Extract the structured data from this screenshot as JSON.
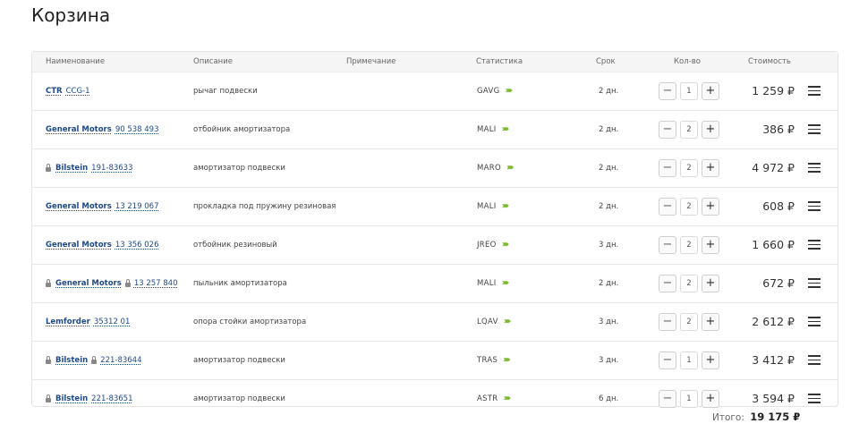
{
  "page": {
    "title": "Корзина"
  },
  "columns": {
    "name": "Наименование",
    "description": "Описание",
    "note": "Примечание",
    "stats": "Статистика",
    "term": "Срок",
    "qty": "Кол-во",
    "cost": "Стоимость"
  },
  "rows": [
    {
      "brand": "CTR",
      "brand_lock": false,
      "part": "CCG-1",
      "part_lock": false,
      "description": "рычаг подвески",
      "stat": "GAVG",
      "days": "2 дн.",
      "qty": "1",
      "price": "1 259 ₽"
    },
    {
      "brand": "General Motors",
      "brand_lock": false,
      "part": "90 538 493",
      "part_lock": false,
      "description": "отбойник амортизатора",
      "stat": "MALI",
      "days": "2 дн.",
      "qty": "2",
      "price": "386 ₽"
    },
    {
      "brand": "Bilstein",
      "brand_lock": true,
      "part": "191-83633",
      "part_lock": false,
      "description": "амортизатор подвески",
      "stat": "MARO",
      "days": "2 дн.",
      "qty": "2",
      "price": "4 972 ₽"
    },
    {
      "brand": "General Motors",
      "brand_lock": false,
      "part": "13 219 067",
      "part_lock": false,
      "description": "прокладка под пружину резиновая",
      "stat": "MALI",
      "days": "2 дн.",
      "qty": "2",
      "price": "608 ₽"
    },
    {
      "brand": "General Motors",
      "brand_lock": false,
      "part": "13 356 026",
      "part_lock": false,
      "description": "отбойник резиновый",
      "stat": "JREO",
      "days": "3 дн.",
      "qty": "2",
      "price": "1 660 ₽"
    },
    {
      "brand": "General Motors",
      "brand_lock": true,
      "part": "13 257 840",
      "part_lock": true,
      "description": "пыльник амортизатора",
      "stat": "MALI",
      "days": "2 дн.",
      "qty": "2",
      "price": "672 ₽"
    },
    {
      "brand": "Lemforder",
      "brand_lock": false,
      "part": "35312 01",
      "part_lock": false,
      "description": "опора стойки амортизатора",
      "stat": "LQAV",
      "days": "3 дн.",
      "qty": "2",
      "price": "2 612 ₽"
    },
    {
      "brand": "Bilstein",
      "brand_lock": true,
      "part": "221-83644",
      "part_lock": true,
      "description": "амортизатор подвески",
      "stat": "TRAS",
      "days": "3 дн.",
      "qty": "1",
      "price": "3 412 ₽"
    },
    {
      "brand": "Bilstein",
      "brand_lock": true,
      "part": "221-83651",
      "part_lock": false,
      "description": "амортизатор подвески",
      "stat": "ASTR",
      "days": "6 дн.",
      "qty": "1",
      "price": "3 594 ₽"
    }
  ],
  "icons": {
    "decrement": "minus-icon",
    "increment": "plus-icon",
    "menu": "hamburger-menu-icon",
    "lock": "lock-icon",
    "stat_chevrons": "chevrons-right-icon"
  },
  "colors": {
    "link": "#1f4a8a",
    "stat_chevron": "#7cb82f"
  },
  "total": {
    "label": "Итого:",
    "value": "19 175 ₽"
  }
}
